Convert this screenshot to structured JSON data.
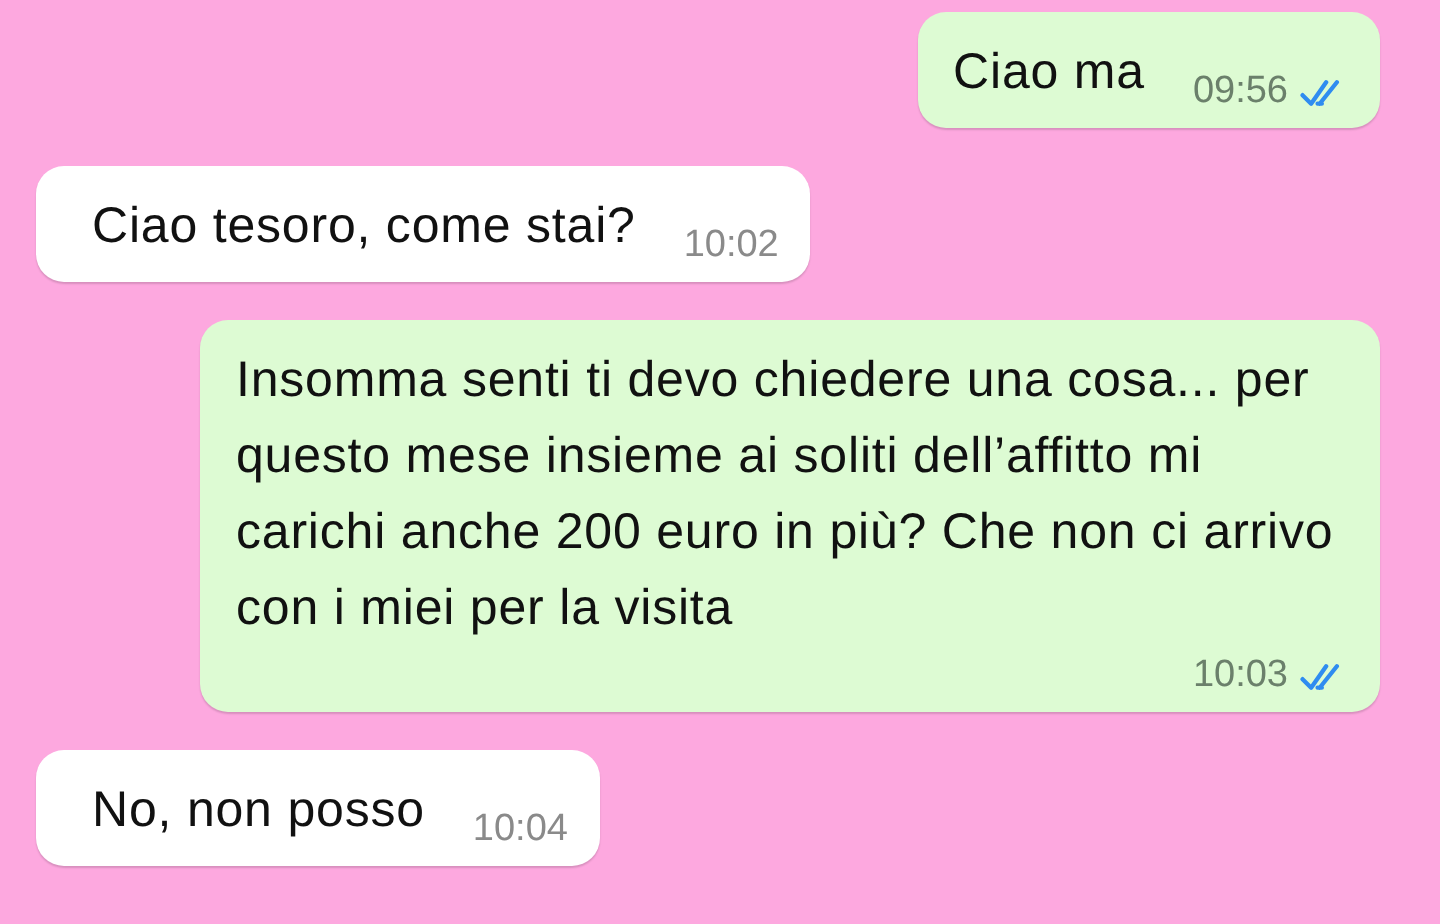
{
  "messages": [
    {
      "kind": "outgoing",
      "text": "Ciao ma",
      "time": "09:56",
      "read": true
    },
    {
      "kind": "incoming",
      "text": "Ciao tesoro, come stai?",
      "time": "10:02"
    },
    {
      "kind": "outgoing",
      "text": "Insomma senti ti devo chiedere una cosa... per questo mese insieme ai soliti dell’affitto mi carichi anche 200 euro in più? Che non ci arrivo con i miei per la visita",
      "time": "10:03",
      "read": true
    },
    {
      "kind": "incoming",
      "text": "No, non posso",
      "time": "10:04"
    }
  ]
}
